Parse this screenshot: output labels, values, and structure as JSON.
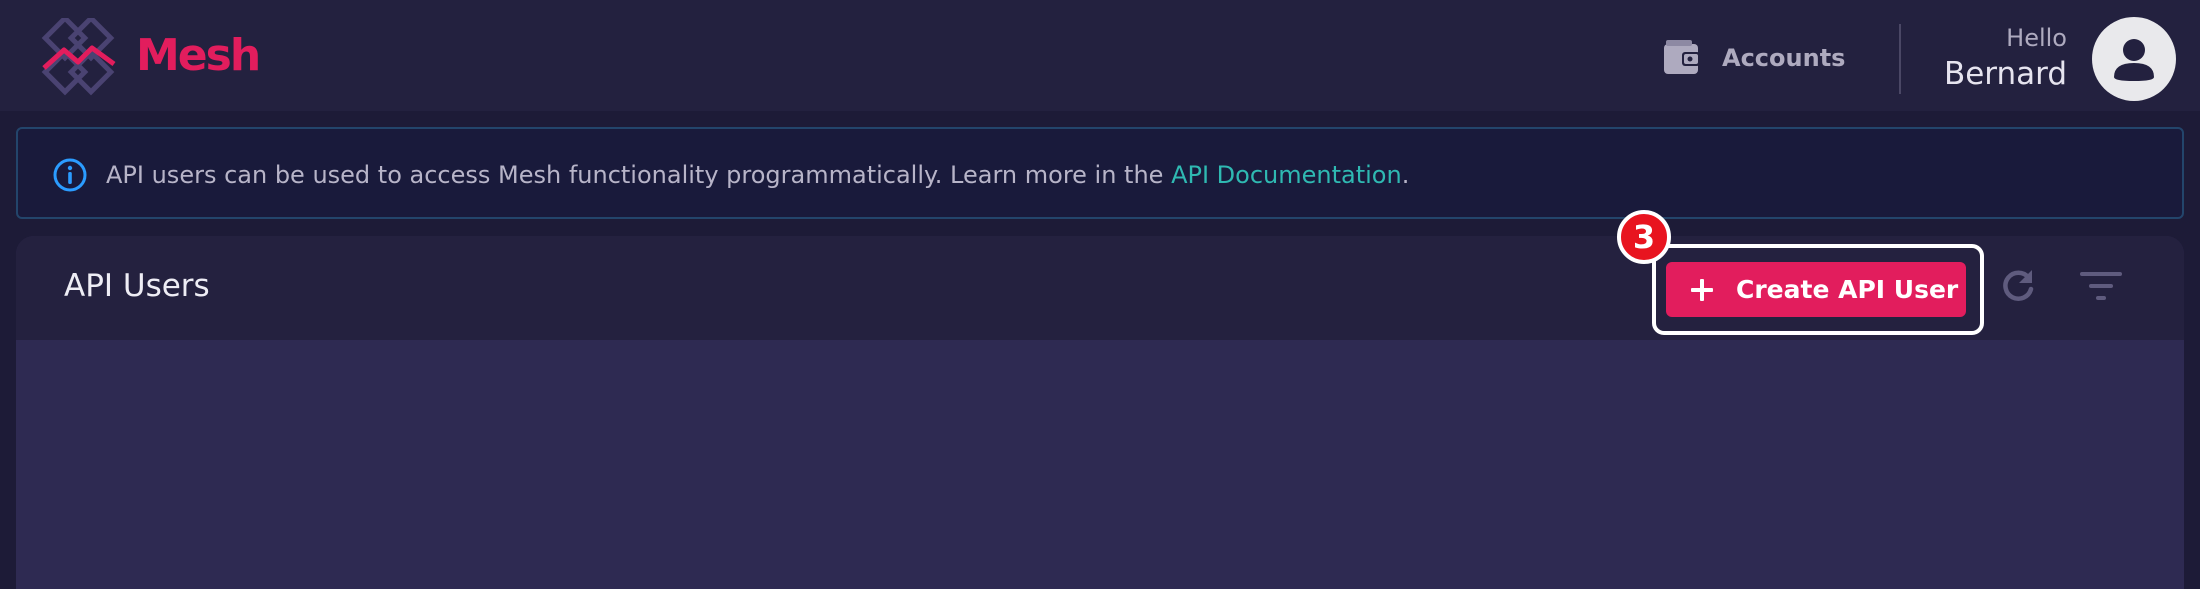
{
  "header": {
    "brand": "Mesh",
    "accounts_label": "Accounts",
    "greeting": "Hello",
    "username": "Bernard"
  },
  "banner": {
    "text": "API users can be used to access Mesh functionality programmatically. Learn more in the ",
    "link_label": "API Documentation",
    "suffix": "."
  },
  "panel": {
    "title": "API Users",
    "create_button_label": "Create API User"
  },
  "annotation": {
    "step_number": "3"
  },
  "icons": {
    "logo": "mesh-logo",
    "accounts": "wallet-icon",
    "avatar": "user-avatar-icon",
    "info": "info-icon",
    "create": "plus-icon",
    "refresh": "refresh-icon",
    "filter": "filter-icon"
  },
  "colors": {
    "brand": "#e21d5d",
    "page_background": "#1d1b37",
    "header_background": "#23213f",
    "panel_background": "#2e2a52",
    "link": "#2fb9b2",
    "annotation_badge": "#e8141f"
  }
}
